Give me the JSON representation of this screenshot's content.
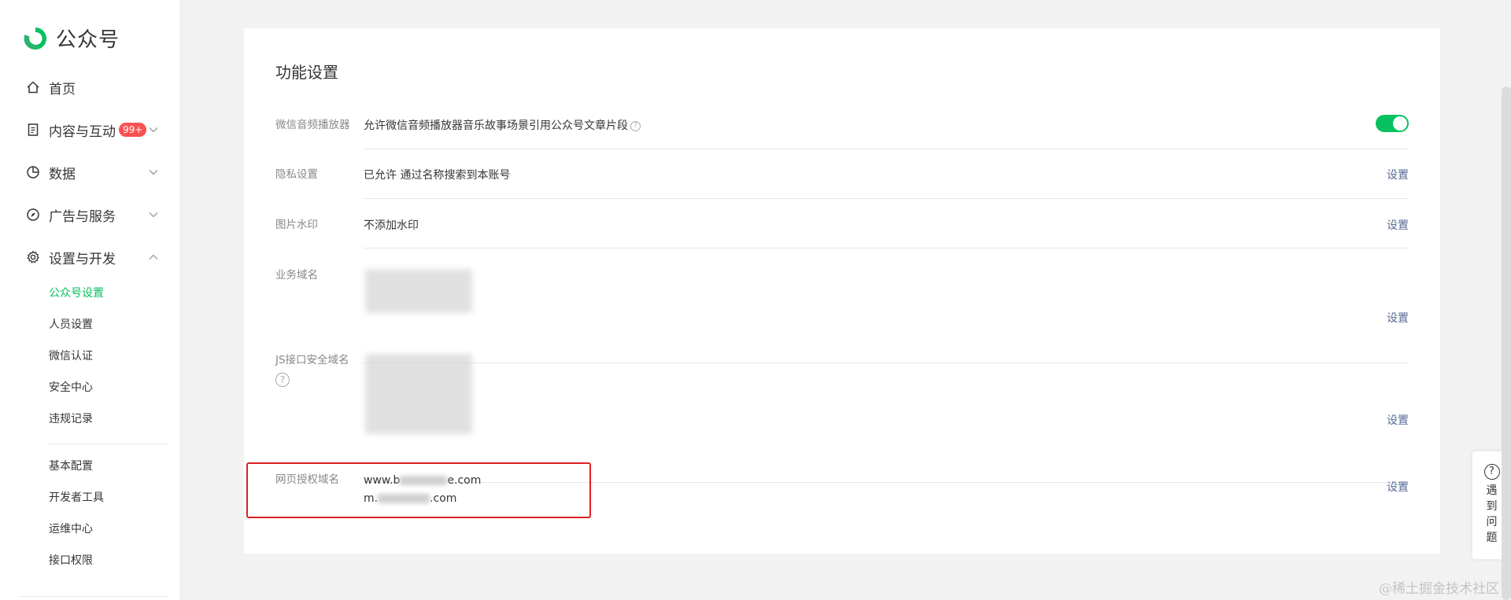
{
  "app": {
    "name": "公众号"
  },
  "sidebar": {
    "items": [
      {
        "label": "首页",
        "icon": "home-icon"
      },
      {
        "label": "内容与互动",
        "icon": "document-icon",
        "badge": "99+"
      },
      {
        "label": "数据",
        "icon": "pie-chart-icon"
      },
      {
        "label": "广告与服务",
        "icon": "compass-icon"
      },
      {
        "label": "设置与开发",
        "icon": "gear-icon"
      }
    ],
    "sub_items_group1": [
      "公众号设置",
      "人员设置",
      "微信认证",
      "安全中心",
      "违规记录"
    ],
    "sub_items_group2": [
      "基本配置",
      "开发者工具",
      "运维中心",
      "接口权限"
    ],
    "active_sub": "公众号设置"
  },
  "main": {
    "title": "功能设置",
    "rows": [
      {
        "label": "微信音频播放器",
        "value": "允许微信音频播放器音乐故事场景引用公众号文章片段",
        "control": "toggle-on"
      },
      {
        "label": "隐私设置",
        "value": "已允许 通过名称搜索到本账号",
        "action": "设置"
      },
      {
        "label": "图片水印",
        "value": "不添加水印",
        "action": "设置"
      },
      {
        "label": "业务域名",
        "value": "",
        "action": "设置"
      },
      {
        "label": "JS接口安全域名",
        "value": "",
        "action": "设置"
      },
      {
        "label": "网页授权域名",
        "value_line1_prefix": "www.b",
        "value_line1_suffix": "e.com",
        "value_line2_prefix": "m.",
        "value_line2_suffix": ".com",
        "action": "设置"
      }
    ]
  },
  "helper": {
    "label": "遇到问题"
  },
  "watermark": "@稀土掘金技术社区",
  "colors": {
    "accent": "#07c160",
    "link": "#576b95",
    "badge": "#fa5151",
    "highlight": "#e02020"
  }
}
